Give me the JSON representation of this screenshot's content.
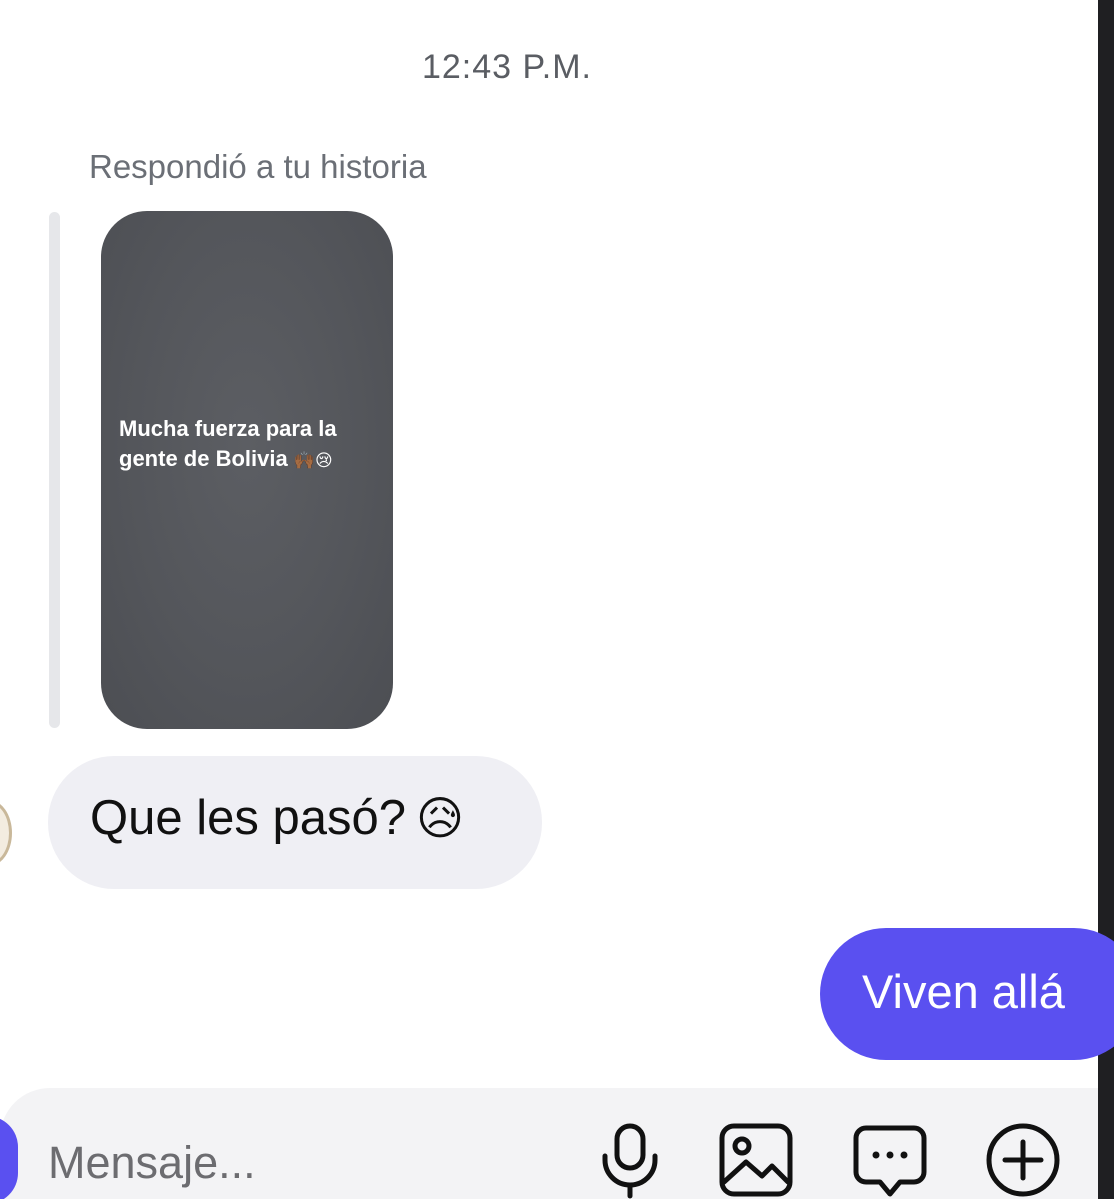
{
  "conversation": {
    "timestamp": "12:43 P.M.",
    "story_reply": {
      "label": "Respondió a tu historia",
      "story_text": "Mucha fuerza para la gente de Bolivia",
      "story_emoji": "🙌🏾😢"
    },
    "messages": [
      {
        "direction": "received",
        "text": "Que les pasó?",
        "emoji": "😥"
      },
      {
        "direction": "sent",
        "text": "Viven allá"
      }
    ]
  },
  "composer": {
    "placeholder": "Mensaje...",
    "icons": [
      "microphone-icon",
      "photo-icon",
      "sticker-icon",
      "add-icon"
    ]
  },
  "colors": {
    "sent_bubble": "#5a50f0",
    "received_bubble": "#efeff4",
    "story_card": "#55575c"
  }
}
